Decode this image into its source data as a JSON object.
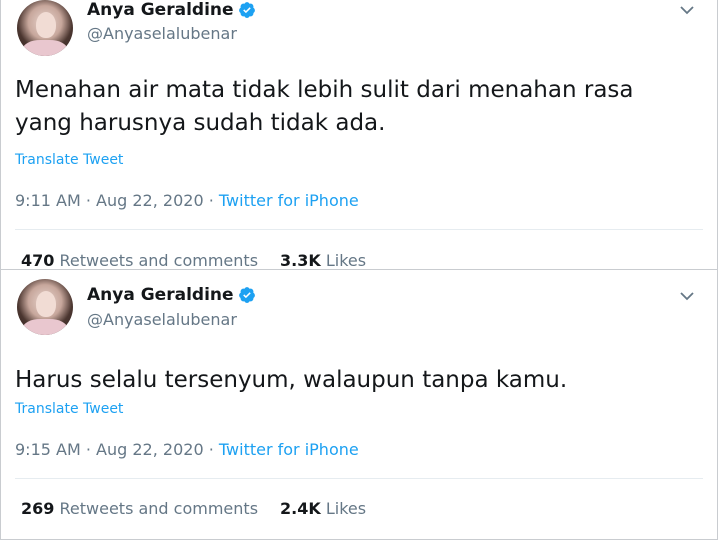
{
  "colors": {
    "link": "#1da1f2",
    "secondary_text": "#657786",
    "primary_text": "#14171a",
    "border": "#c9ccd0"
  },
  "tweets": [
    {
      "author_name": "Anya Geraldine",
      "handle": "@Anyaselalubenar",
      "verified_icon": "verified-badge-icon",
      "more_icon": "chevron-down-icon",
      "text": "Menahan air mata tidak lebih sulit dari menahan rasa yang harusnya sudah tidak ada.",
      "translate_label": "Translate Tweet",
      "time": "9:11 AM",
      "date": "Aug 22, 2020",
      "separator": "·",
      "source": "Twitter for iPhone",
      "retweets_count": "470",
      "retweets_label": "Retweets and comments",
      "likes_count": "3.3K",
      "likes_label": "Likes"
    },
    {
      "author_name": "Anya Geraldine",
      "handle": "@Anyaselalubenar",
      "verified_icon": "verified-badge-icon",
      "more_icon": "chevron-down-icon",
      "text": "Harus selalu tersenyum, walaupun tanpa kamu.",
      "translate_label": "Translate Tweet",
      "time": "9:15 AM",
      "date": "Aug 22, 2020",
      "separator": "·",
      "source": "Twitter for iPhone",
      "retweets_count": "269",
      "retweets_label": "Retweets and comments",
      "likes_count": "2.4K",
      "likes_label": "Likes"
    }
  ]
}
